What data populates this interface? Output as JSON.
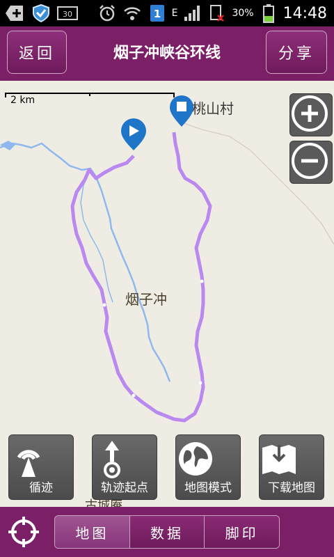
{
  "status": {
    "time": "14:48",
    "battery": "30%",
    "network": "E",
    "notification_count": "1"
  },
  "header": {
    "back_label": "返回",
    "title": "烟子冲峡谷环线",
    "share_label": "分享"
  },
  "map": {
    "scale_label": "2 km",
    "village_label": "桃山村",
    "place_label": "烟子冲",
    "bottom_label": "古城庵",
    "track_color": "#b989f0",
    "river_color": "#8fb8ef"
  },
  "tools": [
    {
      "label": "循迹",
      "icon": "signal-tower-icon"
    },
    {
      "label": "轨迹起点",
      "icon": "track-start-icon"
    },
    {
      "label": "地图模式",
      "icon": "globe-icon"
    },
    {
      "label": "下载地图",
      "icon": "download-map-icon"
    }
  ],
  "tabs": [
    {
      "label": "地图",
      "active": true
    },
    {
      "label": "数据",
      "active": false
    },
    {
      "label": "脚印",
      "active": false
    }
  ]
}
